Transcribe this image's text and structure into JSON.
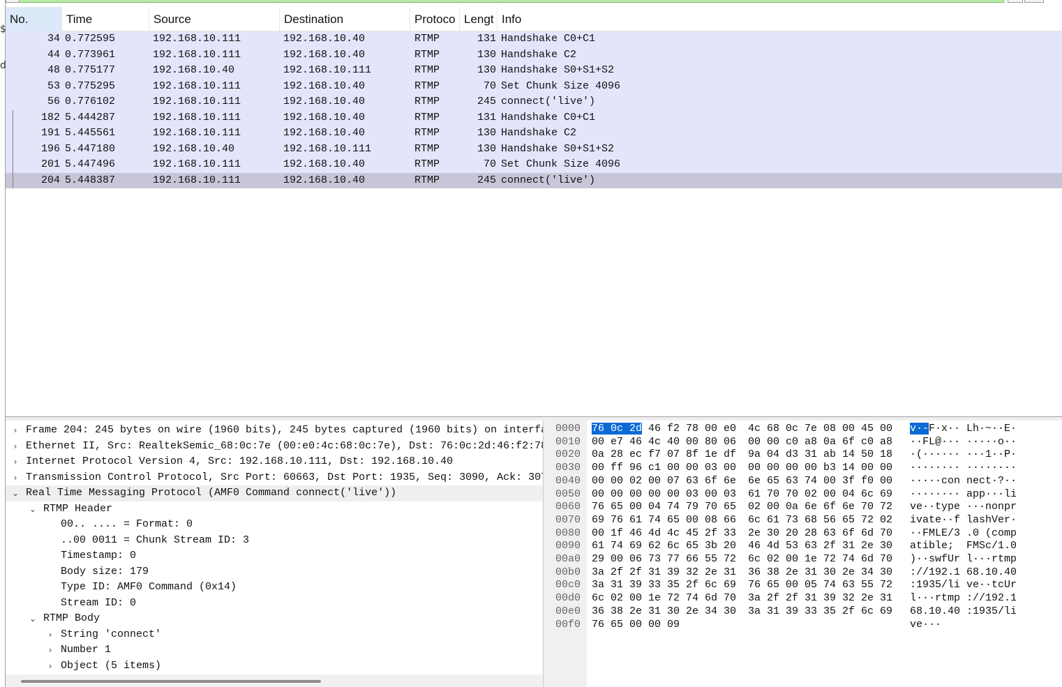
{
  "packet_list": {
    "columns": [
      "No.",
      "Time",
      "Source",
      "Destination",
      "Protoco",
      "Lengt",
      "Info"
    ],
    "rows": [
      {
        "no": "34",
        "time": "0.772595",
        "src": "192.168.10.111",
        "dst": "192.168.10.40",
        "proto": "RTMP",
        "len": "131",
        "info": "Handshake C0+C1"
      },
      {
        "no": "44",
        "time": "0.773961",
        "src": "192.168.10.111",
        "dst": "192.168.10.40",
        "proto": "RTMP",
        "len": "130",
        "info": "Handshake C2"
      },
      {
        "no": "48",
        "time": "0.775177",
        "src": "192.168.10.40",
        "dst": "192.168.10.111",
        "proto": "RTMP",
        "len": "130",
        "info": "Handshake S0+S1+S2"
      },
      {
        "no": "53",
        "time": "0.775295",
        "src": "192.168.10.111",
        "dst": "192.168.10.40",
        "proto": "RTMP",
        "len": "70",
        "info": "Set Chunk Size 4096"
      },
      {
        "no": "56",
        "time": "0.776102",
        "src": "192.168.10.111",
        "dst": "192.168.10.40",
        "proto": "RTMP",
        "len": "245",
        "info": "connect('live')"
      },
      {
        "no": "182",
        "time": "5.444287",
        "src": "192.168.10.111",
        "dst": "192.168.10.40",
        "proto": "RTMP",
        "len": "131",
        "info": "Handshake C0+C1"
      },
      {
        "no": "191",
        "time": "5.445561",
        "src": "192.168.10.111",
        "dst": "192.168.10.40",
        "proto": "RTMP",
        "len": "130",
        "info": "Handshake C2"
      },
      {
        "no": "196",
        "time": "5.447180",
        "src": "192.168.10.40",
        "dst": "192.168.10.111",
        "proto": "RTMP",
        "len": "130",
        "info": "Handshake S0+S1+S2"
      },
      {
        "no": "201",
        "time": "5.447496",
        "src": "192.168.10.111",
        "dst": "192.168.10.40",
        "proto": "RTMP",
        "len": "70",
        "info": "Set Chunk Size 4096"
      },
      {
        "no": "204",
        "time": "5.448387",
        "src": "192.168.10.111",
        "dst": "192.168.10.40",
        "proto": "RTMP",
        "len": "245",
        "info": "connect('live')"
      }
    ]
  },
  "details": {
    "rows": [
      {
        "arrow": "›",
        "text": "Frame 204: 245 bytes on wire (1960 bits), 245 bytes captured (1960 bits) on interfa"
      },
      {
        "arrow": "›",
        "text": "Ethernet II, Src: RealtekSemic_68:0c:7e (00:e0:4c:68:0c:7e), Dst: 76:0c:2d:46:f2:78"
      },
      {
        "arrow": "›",
        "text": "Internet Protocol Version 4, Src: 192.168.10.111, Dst: 192.168.10.40"
      },
      {
        "arrow": "›",
        "text": "Transmission Control Protocol, Src Port: 60663, Dst Port: 1935, Seq: 3090, Ack: 307"
      },
      {
        "arrow": "⌄",
        "text": "Real Time Messaging Protocol (AMF0 Command connect('live'))"
      },
      {
        "arrow": "⌄",
        "text": "RTMP Header"
      },
      {
        "arrow": "",
        "text": "00.. .... = Format: 0"
      },
      {
        "arrow": "",
        "text": "..00 0011 = Chunk Stream ID: 3"
      },
      {
        "arrow": "",
        "text": "Timestamp: 0"
      },
      {
        "arrow": "",
        "text": "Body size: 179"
      },
      {
        "arrow": "",
        "text": "Type ID: AMF0 Command (0x14)"
      },
      {
        "arrow": "",
        "text": "Stream ID: 0"
      },
      {
        "arrow": "⌄",
        "text": "RTMP Body"
      },
      {
        "arrow": "›",
        "text": "String 'connect'"
      },
      {
        "arrow": "›",
        "text": "Number 1"
      },
      {
        "arrow": "›",
        "text": "Object (5 items)"
      }
    ]
  },
  "bytes": {
    "rows": [
      {
        "off": "0000",
        "h1": "76 0c 2d 46 f2 78 00 e0",
        "h2": "4c 68 0c 7e 08 00 45 00",
        "a1": "v·-F·x··",
        "a2": "Lh·~··E·"
      },
      {
        "off": "0010",
        "h1": "00 e7 46 4c 40 00 80 06",
        "h2": "00 00 c0 a8 0a 6f c0 a8",
        "a1": "··FL@···",
        "a2": "·····o··"
      },
      {
        "off": "0020",
        "h1": "0a 28 ec f7 07 8f 1e df",
        "h2": "9a 04 d3 31 ab 14 50 18",
        "a1": "·(······",
        "a2": "···1··P·"
      },
      {
        "off": "0030",
        "h1": "00 ff 96 c1 00 00 03 00",
        "h2": "00 00 00 00 b3 14 00 00",
        "a1": "········",
        "a2": "········"
      },
      {
        "off": "0040",
        "h1": "00 00 02 00 07 63 6f 6e",
        "h2": "6e 65 63 74 00 3f f0 00",
        "a1": "·····con",
        "a2": "nect·?··"
      },
      {
        "off": "0050",
        "h1": "00 00 00 00 00 03 00 03",
        "h2": "61 70 70 02 00 04 6c 69",
        "a1": "········",
        "a2": "app···li"
      },
      {
        "off": "0060",
        "h1": "76 65 00 04 74 79 70 65",
        "h2": "02 00 0a 6e 6f 6e 70 72",
        "a1": "ve··type",
        "a2": "···nonpr"
      },
      {
        "off": "0070",
        "h1": "69 76 61 74 65 00 08 66",
        "h2": "6c 61 73 68 56 65 72 02",
        "a1": "ivate··f",
        "a2": "lashVer·"
      },
      {
        "off": "0080",
        "h1": "00 1f 46 4d 4c 45 2f 33",
        "h2": "2e 30 20 28 63 6f 6d 70",
        "a1": "··FMLE/3",
        "a2": ".0 (comp"
      },
      {
        "off": "0090",
        "h1": "61 74 69 62 6c 65 3b 20",
        "h2": "46 4d 53 63 2f 31 2e 30",
        "a1": "atible; ",
        "a2": "FMSc/1.0"
      },
      {
        "off": "00a0",
        "h1": "29 00 06 73 77 66 55 72",
        "h2": "6c 02 00 1e 72 74 6d 70",
        "a1": ")··swfUr",
        "a2": "l···rtmp"
      },
      {
        "off": "00b0",
        "h1": "3a 2f 2f 31 39 32 2e 31",
        "h2": "36 38 2e 31 30 2e 34 30",
        "a1": "://192.1",
        "a2": "68.10.40"
      },
      {
        "off": "00c0",
        "h1": "3a 31 39 33 35 2f 6c 69",
        "h2": "76 65 00 05 74 63 55 72",
        "a1": ":1935/li",
        "a2": "ve··tcUr"
      },
      {
        "off": "00d0",
        "h1": "6c 02 00 1e 72 74 6d 70",
        "h2": "3a 2f 2f 31 39 32 2e 31",
        "a1": "l···rtmp",
        "a2": "://192.1"
      },
      {
        "off": "00e0",
        "h1": "36 38 2e 31 30 2e 34 30",
        "h2": "3a 31 39 33 35 2f 6c 69",
        "a1": "68.10.40",
        "a2": ":1935/li"
      },
      {
        "off": "00f0",
        "h1": "76 65 00 00 09",
        "h2": "",
        "a1": "ve···",
        "a2": ""
      }
    ]
  },
  "colors": {
    "row_bg": "#e4e4fb",
    "row_selected_bg": "#c6c6d8",
    "byte_selection": "#0b6ad6",
    "filter_bar": "#b8e9a7"
  },
  "icons": {
    "expand_collapsed": "chevron-right-icon",
    "expand_open": "chevron-down-icon"
  }
}
